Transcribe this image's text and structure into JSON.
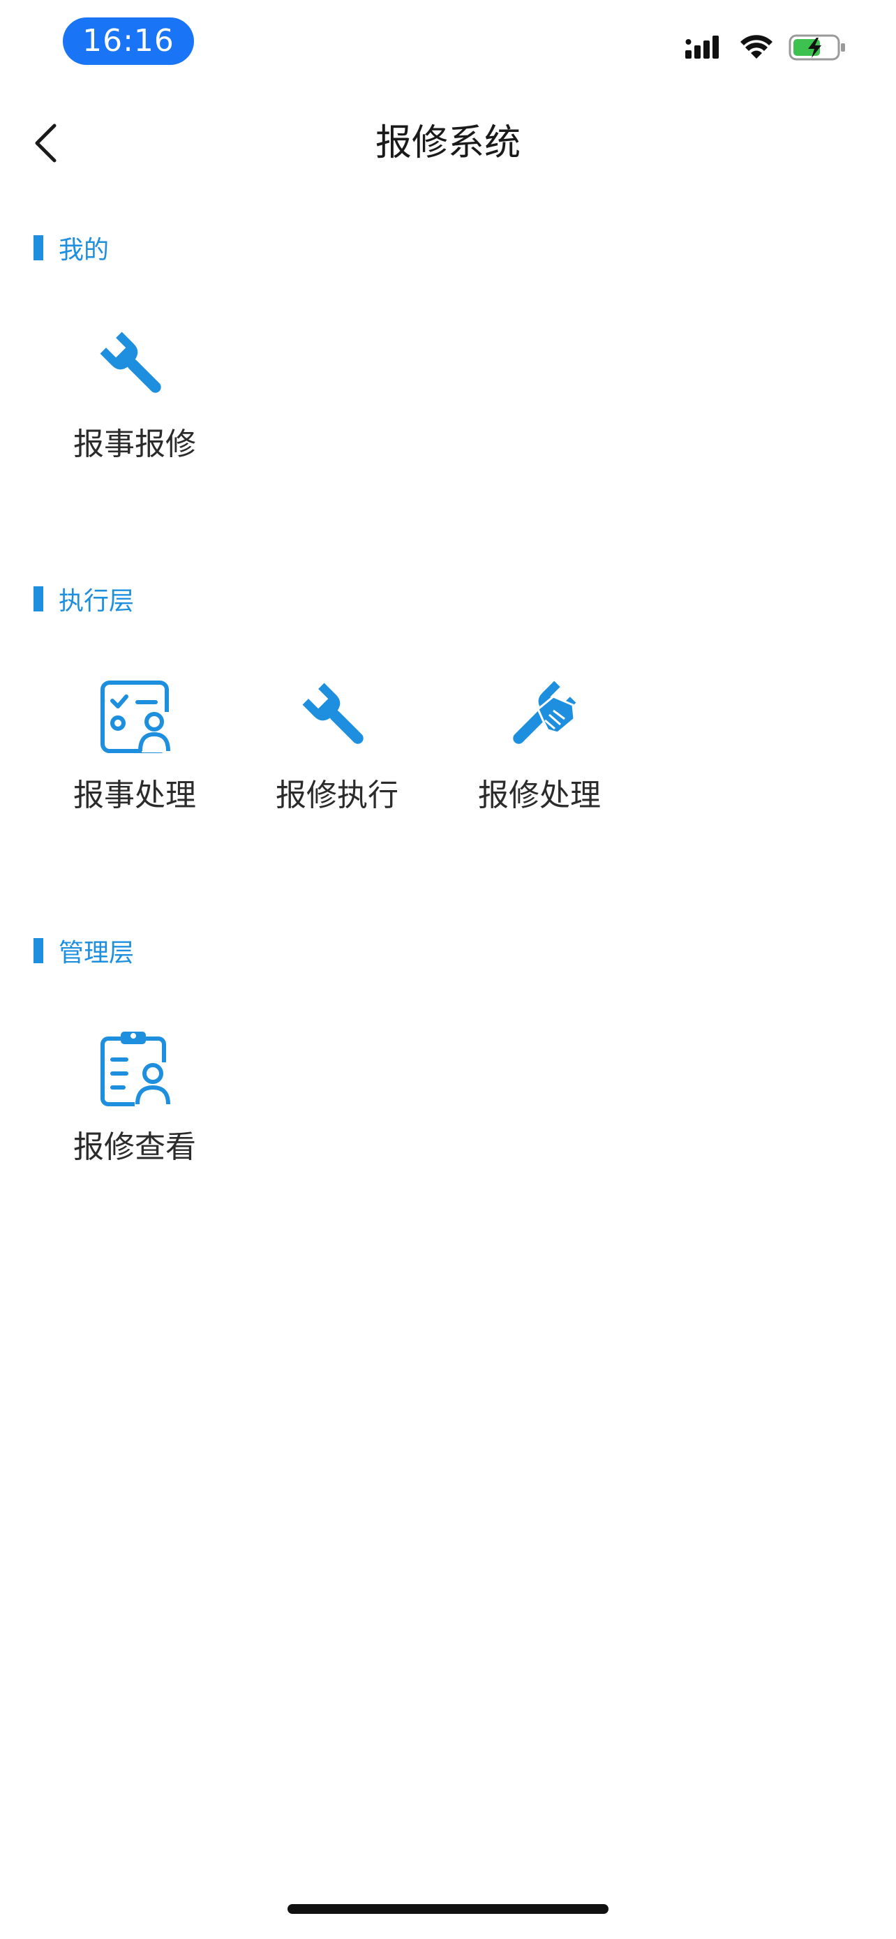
{
  "status_bar": {
    "time": "16:16"
  },
  "nav": {
    "title": "报修系统"
  },
  "sections": [
    {
      "title": "我的",
      "items": [
        {
          "label": "报事报修",
          "icon": "wrench-icon"
        }
      ]
    },
    {
      "title": "执行层",
      "items": [
        {
          "label": "报事处理",
          "icon": "task-checklist-person-icon"
        },
        {
          "label": "报修执行",
          "icon": "wrench-icon"
        },
        {
          "label": "报修处理",
          "icon": "wrench-hand-icon"
        }
      ]
    },
    {
      "title": "管理层",
      "items": [
        {
          "label": "报修查看",
          "icon": "clipboard-person-icon"
        }
      ]
    }
  ],
  "colors": {
    "accent": "#1e8fde",
    "time_pill": "#1a74f6"
  }
}
